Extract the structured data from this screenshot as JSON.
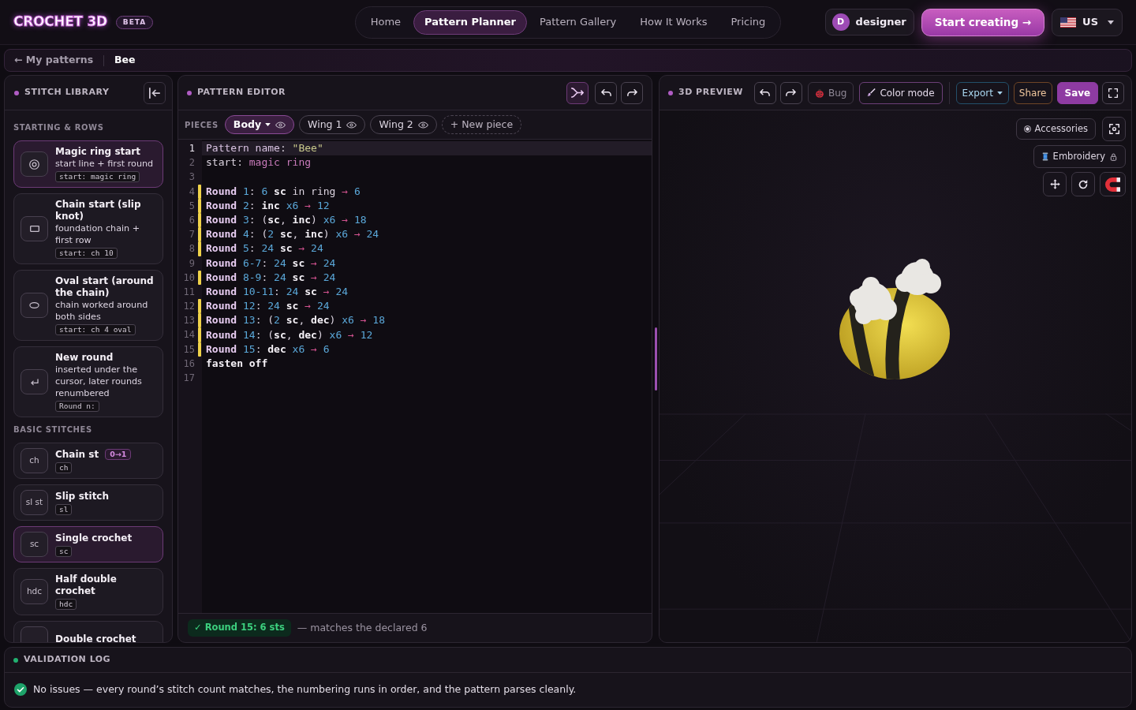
{
  "header": {
    "logo": "CROCHET 3D",
    "badge": "BETA",
    "nav": [
      {
        "label": "Home",
        "selected": false
      },
      {
        "label": "Pattern Planner",
        "selected": true
      },
      {
        "label": "Pattern Gallery",
        "selected": false
      },
      {
        "label": "How It Works",
        "selected": false
      },
      {
        "label": "Pricing",
        "selected": false
      }
    ],
    "user": {
      "initial": "D",
      "name": "designer"
    },
    "cta": "Start creating →",
    "region": "US"
  },
  "breadcrumb": {
    "back": "← My patterns",
    "current": "Bee"
  },
  "stitch_library": {
    "title": "STITCH LIBRARY",
    "sections": [
      {
        "heading": "STARTING & ROWS",
        "items": [
          {
            "kind": "ring",
            "name": "Magic ring start",
            "description": "start line + first round",
            "code": "start: magic ring",
            "highlighted": true
          },
          {
            "kind": "bar",
            "name": "Chain start (slip knot)",
            "description": "foundation chain + first row",
            "code": "start: ch 10",
            "highlighted": false
          },
          {
            "kind": "oval",
            "name": "Oval start (around the chain)",
            "description": "chain worked around both sides",
            "code": "start: ch 4 oval",
            "highlighted": false
          },
          {
            "kind": "return",
            "name": "New round",
            "description": "inserted under the cursor, later rounds renumbered",
            "code": "Round n:",
            "highlighted": false
          }
        ]
      },
      {
        "heading": "BASIC STITCHES",
        "items": [
          {
            "kind": "abbr",
            "abbreviation": "ch",
            "name": "Chain st",
            "badge": "0→1",
            "code": "ch",
            "highlighted": false
          },
          {
            "kind": "abbr",
            "abbreviation": "sl st",
            "name": "Slip stitch",
            "code": "sl",
            "highlighted": false
          },
          {
            "kind": "abbr",
            "abbreviation": "sc",
            "name": "Single crochet",
            "code": "sc",
            "highlighted": true
          },
          {
            "kind": "abbr",
            "abbreviation": "hdc",
            "name": "Half double crochet",
            "code": "hdc",
            "highlighted": false
          },
          {
            "kind": "abbr",
            "name": "Double crochet",
            "highlighted": false
          }
        ]
      }
    ]
  },
  "editor": {
    "title": "PATTERN EDITOR",
    "tools": [
      {
        "kind": "wrap",
        "active": true
      },
      {
        "kind": "undo",
        "active": false
      },
      {
        "kind": "redo",
        "active": false
      }
    ],
    "pieces_label": "PIECES",
    "pieces": [
      {
        "label": "Body",
        "selected": true
      },
      {
        "label": "Wing 1",
        "selected": false
      },
      {
        "label": "Wing 2",
        "selected": false
      }
    ],
    "new_piece": "+ New piece",
    "lines": [
      {
        "number": "1",
        "current": true,
        "marked": false,
        "tokens": [
          {
            "kind": "label",
            "text": "Pattern name"
          },
          {
            "kind": "plain",
            "text": ": "
          },
          {
            "kind": "string",
            "text": "\"Bee\""
          }
        ]
      },
      {
        "number": "2",
        "current": false,
        "marked": false,
        "tokens": [
          {
            "kind": "plain",
            "text": "start: "
          },
          {
            "kind": "value",
            "text": "magic ring"
          }
        ]
      },
      {
        "number": "3",
        "current": false,
        "marked": false
      },
      {
        "number": "4",
        "current": false,
        "marked": true,
        "tokens": [
          {
            "kind": "keyword",
            "text": "Round "
          },
          {
            "kind": "number",
            "text": "1"
          },
          {
            "kind": "plain",
            "text": ": "
          },
          {
            "kind": "number",
            "text": "6 "
          },
          {
            "kind": "stitch",
            "text": "sc"
          },
          {
            "kind": "plain",
            "text": " in ring "
          },
          {
            "kind": "arrow",
            "text": "→ "
          },
          {
            "kind": "number",
            "text": "6"
          }
        ]
      },
      {
        "number": "5",
        "current": false,
        "marked": true,
        "tokens": [
          {
            "kind": "keyword",
            "text": "Round "
          },
          {
            "kind": "number",
            "text": "2"
          },
          {
            "kind": "plain",
            "text": ": "
          },
          {
            "kind": "stitch",
            "text": "inc "
          },
          {
            "kind": "number",
            "text": "x6 "
          },
          {
            "kind": "arrow",
            "text": "→ "
          },
          {
            "kind": "number",
            "text": "12"
          }
        ]
      },
      {
        "number": "6",
        "current": false,
        "marked": true,
        "tokens": [
          {
            "kind": "keyword",
            "text": "Round "
          },
          {
            "kind": "number",
            "text": "3"
          },
          {
            "kind": "plain",
            "text": ": ("
          },
          {
            "kind": "stitch",
            "text": "sc"
          },
          {
            "kind": "plain",
            "text": ", "
          },
          {
            "kind": "stitch",
            "text": "inc"
          },
          {
            "kind": "plain",
            "text": ") "
          },
          {
            "kind": "number",
            "text": "x6 "
          },
          {
            "kind": "arrow",
            "text": "→ "
          },
          {
            "kind": "number",
            "text": "18"
          }
        ]
      },
      {
        "number": "7",
        "current": false,
        "marked": true,
        "tokens": [
          {
            "kind": "keyword",
            "text": "Round "
          },
          {
            "kind": "number",
            "text": "4"
          },
          {
            "kind": "plain",
            "text": ": ("
          },
          {
            "kind": "number",
            "text": "2 "
          },
          {
            "kind": "stitch",
            "text": "sc"
          },
          {
            "kind": "plain",
            "text": ", "
          },
          {
            "kind": "stitch",
            "text": "inc"
          },
          {
            "kind": "plain",
            "text": ") "
          },
          {
            "kind": "number",
            "text": "x6 "
          },
          {
            "kind": "arrow",
            "text": "→ "
          },
          {
            "kind": "number",
            "text": "24"
          }
        ]
      },
      {
        "number": "8",
        "current": false,
        "marked": true,
        "tokens": [
          {
            "kind": "keyword",
            "text": "Round "
          },
          {
            "kind": "number",
            "text": "5"
          },
          {
            "kind": "plain",
            "text": ": "
          },
          {
            "kind": "number",
            "text": "24 "
          },
          {
            "kind": "stitch",
            "text": "sc "
          },
          {
            "kind": "arrow",
            "text": "→ "
          },
          {
            "kind": "number",
            "text": "24"
          }
        ]
      },
      {
        "number": "9",
        "current": false,
        "marked": false,
        "tokens": [
          {
            "kind": "keyword",
            "text": "Round "
          },
          {
            "kind": "number",
            "text": "6-7"
          },
          {
            "kind": "plain",
            "text": ": "
          },
          {
            "kind": "number",
            "text": "24 "
          },
          {
            "kind": "stitch",
            "text": "sc "
          },
          {
            "kind": "arrow",
            "text": "→ "
          },
          {
            "kind": "number",
            "text": "24"
          }
        ]
      },
      {
        "number": "10",
        "current": false,
        "marked": true,
        "tokens": [
          {
            "kind": "keyword",
            "text": "Round "
          },
          {
            "kind": "number",
            "text": "8-9"
          },
          {
            "kind": "plain",
            "text": ": "
          },
          {
            "kind": "number",
            "text": "24 "
          },
          {
            "kind": "stitch",
            "text": "sc "
          },
          {
            "kind": "arrow",
            "text": "→ "
          },
          {
            "kind": "number",
            "text": "24"
          }
        ]
      },
      {
        "number": "11",
        "current": false,
        "marked": false,
        "tokens": [
          {
            "kind": "keyword",
            "text": "Round "
          },
          {
            "kind": "number",
            "text": "10-11"
          },
          {
            "kind": "plain",
            "text": ": "
          },
          {
            "kind": "number",
            "text": "24 "
          },
          {
            "kind": "stitch",
            "text": "sc "
          },
          {
            "kind": "arrow",
            "text": "→ "
          },
          {
            "kind": "number",
            "text": "24"
          }
        ]
      },
      {
        "number": "12",
        "current": false,
        "marked": true,
        "tokens": [
          {
            "kind": "keyword",
            "text": "Round "
          },
          {
            "kind": "number",
            "text": "12"
          },
          {
            "kind": "plain",
            "text": ": "
          },
          {
            "kind": "number",
            "text": "24 "
          },
          {
            "kind": "stitch",
            "text": "sc "
          },
          {
            "kind": "arrow",
            "text": "→ "
          },
          {
            "kind": "number",
            "text": "24"
          }
        ]
      },
      {
        "number": "13",
        "current": false,
        "marked": true,
        "tokens": [
          {
            "kind": "keyword",
            "text": "Round "
          },
          {
            "kind": "number",
            "text": "13"
          },
          {
            "kind": "plain",
            "text": ": ("
          },
          {
            "kind": "number",
            "text": "2 "
          },
          {
            "kind": "stitch",
            "text": "sc"
          },
          {
            "kind": "plain",
            "text": ", "
          },
          {
            "kind": "stitch",
            "text": "dec"
          },
          {
            "kind": "plain",
            "text": ") "
          },
          {
            "kind": "number",
            "text": "x6 "
          },
          {
            "kind": "arrow",
            "text": "→ "
          },
          {
            "kind": "number",
            "text": "18"
          }
        ]
      },
      {
        "number": "14",
        "current": false,
        "marked": true,
        "tokens": [
          {
            "kind": "keyword",
            "text": "Round "
          },
          {
            "kind": "number",
            "text": "14"
          },
          {
            "kind": "plain",
            "text": ": ("
          },
          {
            "kind": "stitch",
            "text": "sc"
          },
          {
            "kind": "plain",
            "text": ", "
          },
          {
            "kind": "stitch",
            "text": "dec"
          },
          {
            "kind": "plain",
            "text": ") "
          },
          {
            "kind": "number",
            "text": "x6 "
          },
          {
            "kind": "arrow",
            "text": "→ "
          },
          {
            "kind": "number",
            "text": "12"
          }
        ]
      },
      {
        "number": "15",
        "current": false,
        "marked": true,
        "tokens": [
          {
            "kind": "keyword",
            "text": "Round "
          },
          {
            "kind": "number",
            "text": "15"
          },
          {
            "kind": "plain",
            "text": ": "
          },
          {
            "kind": "stitch",
            "text": "dec "
          },
          {
            "kind": "number",
            "text": "x6 "
          },
          {
            "kind": "arrow",
            "text": "→ "
          },
          {
            "kind": "number",
            "text": "6"
          }
        ]
      },
      {
        "number": "16",
        "current": false,
        "marked": false,
        "tokens": [
          {
            "kind": "stitch",
            "text": "fasten off"
          }
        ]
      },
      {
        "number": "17",
        "current": false,
        "marked": false
      }
    ],
    "status": {
      "kind": "ok",
      "count": "✓ Round 15: 6 sts",
      "message": "— matches the declared 6"
    }
  },
  "preview": {
    "title": "3D PREVIEW",
    "actions": [
      {
        "kind": "undo"
      },
      {
        "kind": "redo"
      },
      {
        "kind": "bug",
        "label": "Bug"
      },
      {
        "kind": "paint",
        "label": "Color mode"
      },
      {
        "kind": "export",
        "label": "Export"
      },
      {
        "kind": "share",
        "label": "Share"
      },
      {
        "kind": "save",
        "label": "Save"
      },
      {
        "kind": "fullscreen"
      }
    ],
    "overlay": {
      "accessories": "Accessories",
      "embroidery": "Embroidery"
    }
  },
  "validation_log": {
    "title": "VALIDATION LOG",
    "entries": [
      {
        "kind": "ok",
        "message": "No issues — every round’s stitch count matches, the numbering runs in order, and the pattern parses cleanly."
      }
    ]
  }
}
